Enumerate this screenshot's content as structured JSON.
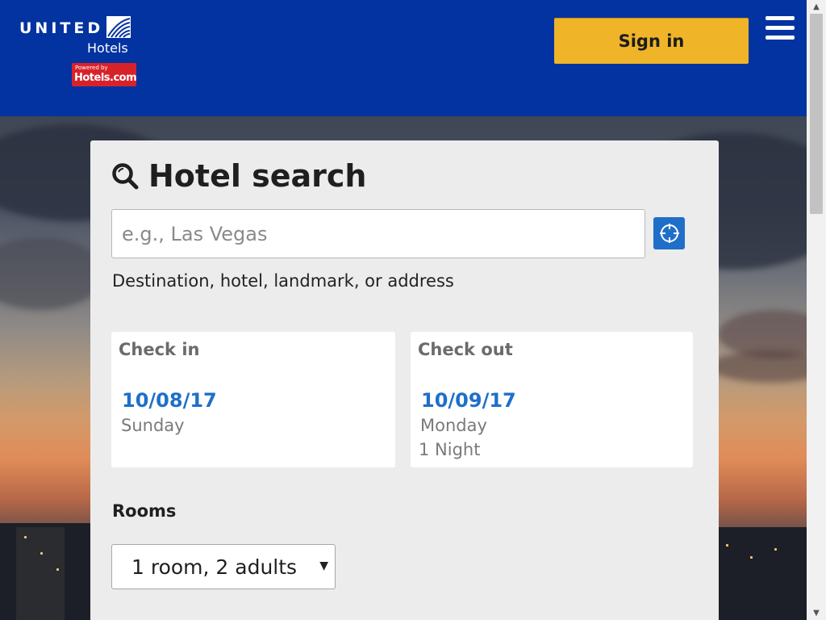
{
  "header": {
    "brand_word": "UNITED",
    "brand_sub": "Hotels",
    "badge_small": "Powered by",
    "badge_main": "Hotels.com",
    "signin_label": "Sign in",
    "menu_icon": "hamburger-menu-icon"
  },
  "search": {
    "title": "Hotel search",
    "title_icon": "search-icon",
    "destination_placeholder": "e.g., Las Vegas",
    "destination_value": "",
    "destination_hint": "Destination, hotel, landmark, or address",
    "locate_icon": "crosshair-locate-icon"
  },
  "checkin": {
    "label": "Check in",
    "date": "10/08/17",
    "day": "Sunday"
  },
  "checkout": {
    "label": "Check out",
    "date": "10/09/17",
    "day": "Monday",
    "nights": "1 Night"
  },
  "rooms": {
    "label": "Rooms",
    "selected": "1 room, 2 adults"
  },
  "colors": {
    "header_bg": "#0233a0",
    "signin_bg": "#f0b428",
    "accent_blue": "#1f6fc9",
    "badge_red": "#d8222a",
    "card_bg": "#ececec"
  }
}
